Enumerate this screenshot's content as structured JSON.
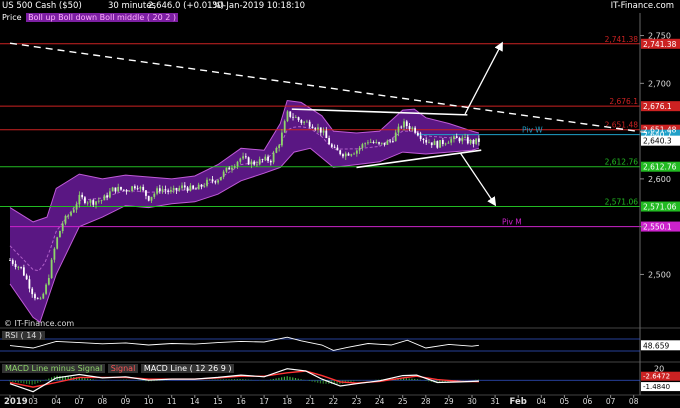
{
  "header": {
    "symbol": "US 500 Cash ($50)",
    "interval": "30 minutes",
    "quote": "2,646.0 (+0.01%)",
    "datetime": "30-Jan-2019 10:18:10",
    "brand": "IT-Finance.com"
  },
  "legend": {
    "label": "Price",
    "indicator": "Boll up  Boll down  Boll middle ( 20 2 )"
  },
  "watermark": "© IT-Finance.com",
  "colors": {
    "background": "#000000",
    "bollinger_fill": "#6a1b9a",
    "bollinger_line": "#c05ad8",
    "candle_up": "#8ed66a",
    "candle_down": "#ffffff",
    "resistance": "#cc2222",
    "support": "#22bb22",
    "pivot_week": "#1fa0c8",
    "pivot_month": "#cc22cc",
    "trendline": "#ffffff",
    "rsi_line": "#ffffff",
    "macd_line": "#ffffff",
    "macd_signal": "#ff3333",
    "macd_hist": "#2e8b2e"
  },
  "chart_data": [
    {
      "type": "candlestick",
      "panel": "price",
      "y_axis_side": "right",
      "ylim": [
        2445,
        2760
      ],
      "y_ticks": [
        2500,
        2550,
        2600,
        2650,
        2700,
        2750
      ],
      "y_tick_labels": [
        "2,500",
        "",
        "2,600",
        "",
        "2,700",
        "2,750"
      ],
      "x_dates": [
        "2019",
        "03",
        "04",
        "07",
        "08",
        "09",
        "10",
        "11",
        "14",
        "15",
        "16",
        "17",
        "18",
        "21",
        "22",
        "23",
        "24",
        "25",
        "28",
        "29",
        "30",
        "31",
        "Feb",
        "04",
        "05",
        "06",
        "07",
        "08"
      ],
      "close_path": [
        {
          "d": 0.0,
          "v": 2515
        },
        {
          "d": 0.5,
          "v": 2506
        },
        {
          "d": 1.0,
          "v": 2480
        },
        {
          "d": 1.3,
          "v": 2470
        },
        {
          "d": 1.6,
          "v": 2490
        },
        {
          "d": 2.0,
          "v": 2535
        },
        {
          "d": 2.3,
          "v": 2555
        },
        {
          "d": 2.7,
          "v": 2567
        },
        {
          "d": 3.0,
          "v": 2580
        },
        {
          "d": 3.5,
          "v": 2576
        },
        {
          "d": 4.0,
          "v": 2578
        },
        {
          "d": 4.5,
          "v": 2590
        },
        {
          "d": 5.0,
          "v": 2588
        },
        {
          "d": 5.5,
          "v": 2594
        },
        {
          "d": 6.0,
          "v": 2580
        },
        {
          "d": 6.5,
          "v": 2590
        },
        {
          "d": 7.0,
          "v": 2586
        },
        {
          "d": 7.5,
          "v": 2592
        },
        {
          "d": 8.0,
          "v": 2588
        },
        {
          "d": 8.5,
          "v": 2596
        },
        {
          "d": 9.0,
          "v": 2600
        },
        {
          "d": 9.5,
          "v": 2612
        },
        {
          "d": 10.0,
          "v": 2622
        },
        {
          "d": 10.5,
          "v": 2616
        },
        {
          "d": 11.0,
          "v": 2620
        },
        {
          "d": 11.3,
          "v": 2620
        },
        {
          "d": 11.7,
          "v": 2640
        },
        {
          "d": 12.0,
          "v": 2668
        },
        {
          "d": 12.3,
          "v": 2665
        },
        {
          "d": 12.6,
          "v": 2660
        },
        {
          "d": 13.0,
          "v": 2658
        },
        {
          "d": 13.5,
          "v": 2650
        },
        {
          "d": 14.0,
          "v": 2630
        },
        {
          "d": 14.5,
          "v": 2626
        },
        {
          "d": 15.0,
          "v": 2630
        },
        {
          "d": 15.5,
          "v": 2640
        },
        {
          "d": 16.0,
          "v": 2635
        },
        {
          "d": 16.5,
          "v": 2640
        },
        {
          "d": 17.0,
          "v": 2658
        },
        {
          "d": 17.5,
          "v": 2652
        },
        {
          "d": 18.0,
          "v": 2640
        },
        {
          "d": 18.5,
          "v": 2636
        },
        {
          "d": 19.0,
          "v": 2641
        },
        {
          "d": 19.5,
          "v": 2642
        },
        {
          "d": 20.0,
          "v": 2638
        },
        {
          "d": 20.3,
          "v": 2640
        }
      ],
      "bollinger_upper": [
        {
          "d": 0.0,
          "v": 2570
        },
        {
          "d": 1.0,
          "v": 2555
        },
        {
          "d": 1.6,
          "v": 2560
        },
        {
          "d": 2.0,
          "v": 2590
        },
        {
          "d": 3.0,
          "v": 2605
        },
        {
          "d": 4.0,
          "v": 2600
        },
        {
          "d": 5.0,
          "v": 2604
        },
        {
          "d": 6.0,
          "v": 2602
        },
        {
          "d": 7.0,
          "v": 2600
        },
        {
          "d": 8.0,
          "v": 2603
        },
        {
          "d": 9.0,
          "v": 2615
        },
        {
          "d": 10.0,
          "v": 2632
        },
        {
          "d": 11.0,
          "v": 2630
        },
        {
          "d": 11.7,
          "v": 2658
        },
        {
          "d": 12.0,
          "v": 2682
        },
        {
          "d": 12.6,
          "v": 2680
        },
        {
          "d": 13.5,
          "v": 2666
        },
        {
          "d": 14.0,
          "v": 2650
        },
        {
          "d": 15.0,
          "v": 2648
        },
        {
          "d": 16.0,
          "v": 2650
        },
        {
          "d": 17.0,
          "v": 2672
        },
        {
          "d": 17.5,
          "v": 2673
        },
        {
          "d": 18.0,
          "v": 2664
        },
        {
          "d": 19.0,
          "v": 2658
        },
        {
          "d": 20.0,
          "v": 2650
        },
        {
          "d": 20.3,
          "v": 2648
        }
      ],
      "bollinger_lower": [
        {
          "d": 0.0,
          "v": 2490
        },
        {
          "d": 1.0,
          "v": 2455
        },
        {
          "d": 1.3,
          "v": 2450
        },
        {
          "d": 2.0,
          "v": 2500
        },
        {
          "d": 3.0,
          "v": 2550
        },
        {
          "d": 4.0,
          "v": 2560
        },
        {
          "d": 5.0,
          "v": 2572
        },
        {
          "d": 6.0,
          "v": 2570
        },
        {
          "d": 7.0,
          "v": 2574
        },
        {
          "d": 8.0,
          "v": 2576
        },
        {
          "d": 9.0,
          "v": 2584
        },
        {
          "d": 10.0,
          "v": 2598
        },
        {
          "d": 11.0,
          "v": 2606
        },
        {
          "d": 11.7,
          "v": 2612
        },
        {
          "d": 12.3,
          "v": 2628
        },
        {
          "d": 13.0,
          "v": 2632
        },
        {
          "d": 14.0,
          "v": 2612
        },
        {
          "d": 15.0,
          "v": 2615
        },
        {
          "d": 16.0,
          "v": 2618
        },
        {
          "d": 17.0,
          "v": 2628
        },
        {
          "d": 18.0,
          "v": 2626
        },
        {
          "d": 19.0,
          "v": 2628
        },
        {
          "d": 20.0,
          "v": 2630
        },
        {
          "d": 20.3,
          "v": 2632
        }
      ],
      "horizontal_levels": [
        {
          "value": 2741.38,
          "label": "2,741.38",
          "color": "#cc2222"
        },
        {
          "value": 2676.1,
          "label": "2,676.1",
          "color": "#cc2222"
        },
        {
          "value": 2651.48,
          "label": "2,651.48",
          "color": "#cc2222"
        },
        {
          "value": 2612.76,
          "label": "2,612.76",
          "color": "#22bb22"
        },
        {
          "value": 2571.06,
          "label": "2,571.06",
          "color": "#22bb22"
        }
      ],
      "pivots": [
        {
          "name": "Piv W",
          "value": 2646.3,
          "color": "#1fa0c8",
          "price_tag": "2,640.7",
          "start_d": 17.6
        },
        {
          "name": "Piv M",
          "value": 2550.1,
          "color": "#cc22cc",
          "price_tag": "2,550.1",
          "start_d": 0.0
        }
      ],
      "last_price_tag": "2,640.3",
      "trendlines": [
        {
          "style": "dashed",
          "from": {
            "d": 0.0,
            "v": 2742
          },
          "to": {
            "d": 27.7,
            "v": 2648
          }
        },
        {
          "style": "solid",
          "from": {
            "d": 12.2,
            "v": 2673
          },
          "to": {
            "d": 19.8,
            "v": 2667
          }
        },
        {
          "style": "solid",
          "from": {
            "d": 15.0,
            "v": 2612
          },
          "to": {
            "d": 20.4,
            "v": 2630
          }
        }
      ],
      "arrows": [
        {
          "from": {
            "d": 19.7,
            "v": 2668
          },
          "to": {
            "d": 21.3,
            "v": 2742
          }
        },
        {
          "from": {
            "d": 19.5,
            "v": 2627
          },
          "to": {
            "d": 21.0,
            "v": 2573
          }
        }
      ]
    },
    {
      "type": "line",
      "panel": "rsi",
      "name": "RSI ( 14 )",
      "last_value": "48.659",
      "ylim": [
        0,
        100
      ],
      "reference_levels": [
        70,
        30
      ],
      "values": [
        {
          "d": 0.0,
          "v": 48
        },
        {
          "d": 1.0,
          "v": 40
        },
        {
          "d": 2.0,
          "v": 62
        },
        {
          "d": 3.0,
          "v": 58
        },
        {
          "d": 4.0,
          "v": 54
        },
        {
          "d": 5.0,
          "v": 57
        },
        {
          "d": 6.0,
          "v": 50
        },
        {
          "d": 7.0,
          "v": 55
        },
        {
          "d": 8.0,
          "v": 53
        },
        {
          "d": 9.0,
          "v": 58
        },
        {
          "d": 10.0,
          "v": 62
        },
        {
          "d": 11.0,
          "v": 60
        },
        {
          "d": 12.0,
          "v": 76
        },
        {
          "d": 12.6,
          "v": 64
        },
        {
          "d": 13.5,
          "v": 50
        },
        {
          "d": 14.0,
          "v": 32
        },
        {
          "d": 14.6,
          "v": 42
        },
        {
          "d": 15.5,
          "v": 55
        },
        {
          "d": 16.5,
          "v": 50
        },
        {
          "d": 17.2,
          "v": 66
        },
        {
          "d": 18.0,
          "v": 40
        },
        {
          "d": 19.0,
          "v": 52
        },
        {
          "d": 20.0,
          "v": 46
        },
        {
          "d": 20.3,
          "v": 49
        }
      ]
    },
    {
      "type": "line",
      "panel": "macd",
      "legend": [
        "MACD Line minus Signal",
        "Signal",
        "MACD Line ( 12 26 9 )"
      ],
      "last_value": "-1.4840",
      "tick_labels": [
        "20",
        "-2.6472"
      ],
      "ylim": [
        -24,
        30
      ],
      "macd": [
        {
          "d": 0.0,
          "v": -6
        },
        {
          "d": 1.0,
          "v": -20
        },
        {
          "d": 2.0,
          "v": 4
        },
        {
          "d": 3.0,
          "v": 10
        },
        {
          "d": 4.0,
          "v": 4
        },
        {
          "d": 5.0,
          "v": 6
        },
        {
          "d": 6.0,
          "v": 0
        },
        {
          "d": 7.0,
          "v": 2
        },
        {
          "d": 8.0,
          "v": 2
        },
        {
          "d": 9.0,
          "v": 5
        },
        {
          "d": 10.0,
          "v": 9
        },
        {
          "d": 11.0,
          "v": 6
        },
        {
          "d": 12.0,
          "v": 20
        },
        {
          "d": 12.8,
          "v": 16
        },
        {
          "d": 13.5,
          "v": 2
        },
        {
          "d": 14.3,
          "v": -10
        },
        {
          "d": 15.0,
          "v": -6
        },
        {
          "d": 16.0,
          "v": -1
        },
        {
          "d": 17.0,
          "v": 8
        },
        {
          "d": 17.6,
          "v": 9
        },
        {
          "d": 18.5,
          "v": -4
        },
        {
          "d": 19.5,
          "v": -3
        },
        {
          "d": 20.3,
          "v": -1.5
        }
      ],
      "signal": [
        {
          "d": 0.0,
          "v": -4
        },
        {
          "d": 1.0,
          "v": -12
        },
        {
          "d": 2.0,
          "v": -4
        },
        {
          "d": 3.0,
          "v": 5
        },
        {
          "d": 4.0,
          "v": 5
        },
        {
          "d": 5.0,
          "v": 5
        },
        {
          "d": 6.0,
          "v": 2
        },
        {
          "d": 7.0,
          "v": 2
        },
        {
          "d": 8.0,
          "v": 2
        },
        {
          "d": 9.0,
          "v": 4
        },
        {
          "d": 10.0,
          "v": 7
        },
        {
          "d": 11.0,
          "v": 7
        },
        {
          "d": 12.0,
          "v": 13
        },
        {
          "d": 12.8,
          "v": 16
        },
        {
          "d": 13.5,
          "v": 8
        },
        {
          "d": 14.3,
          "v": -3
        },
        {
          "d": 15.0,
          "v": -5
        },
        {
          "d": 16.0,
          "v": -2
        },
        {
          "d": 17.0,
          "v": 4
        },
        {
          "d": 17.6,
          "v": 7
        },
        {
          "d": 18.5,
          "v": 1
        },
        {
          "d": 19.5,
          "v": -2
        },
        {
          "d": 20.3,
          "v": -2.6
        }
      ]
    }
  ]
}
